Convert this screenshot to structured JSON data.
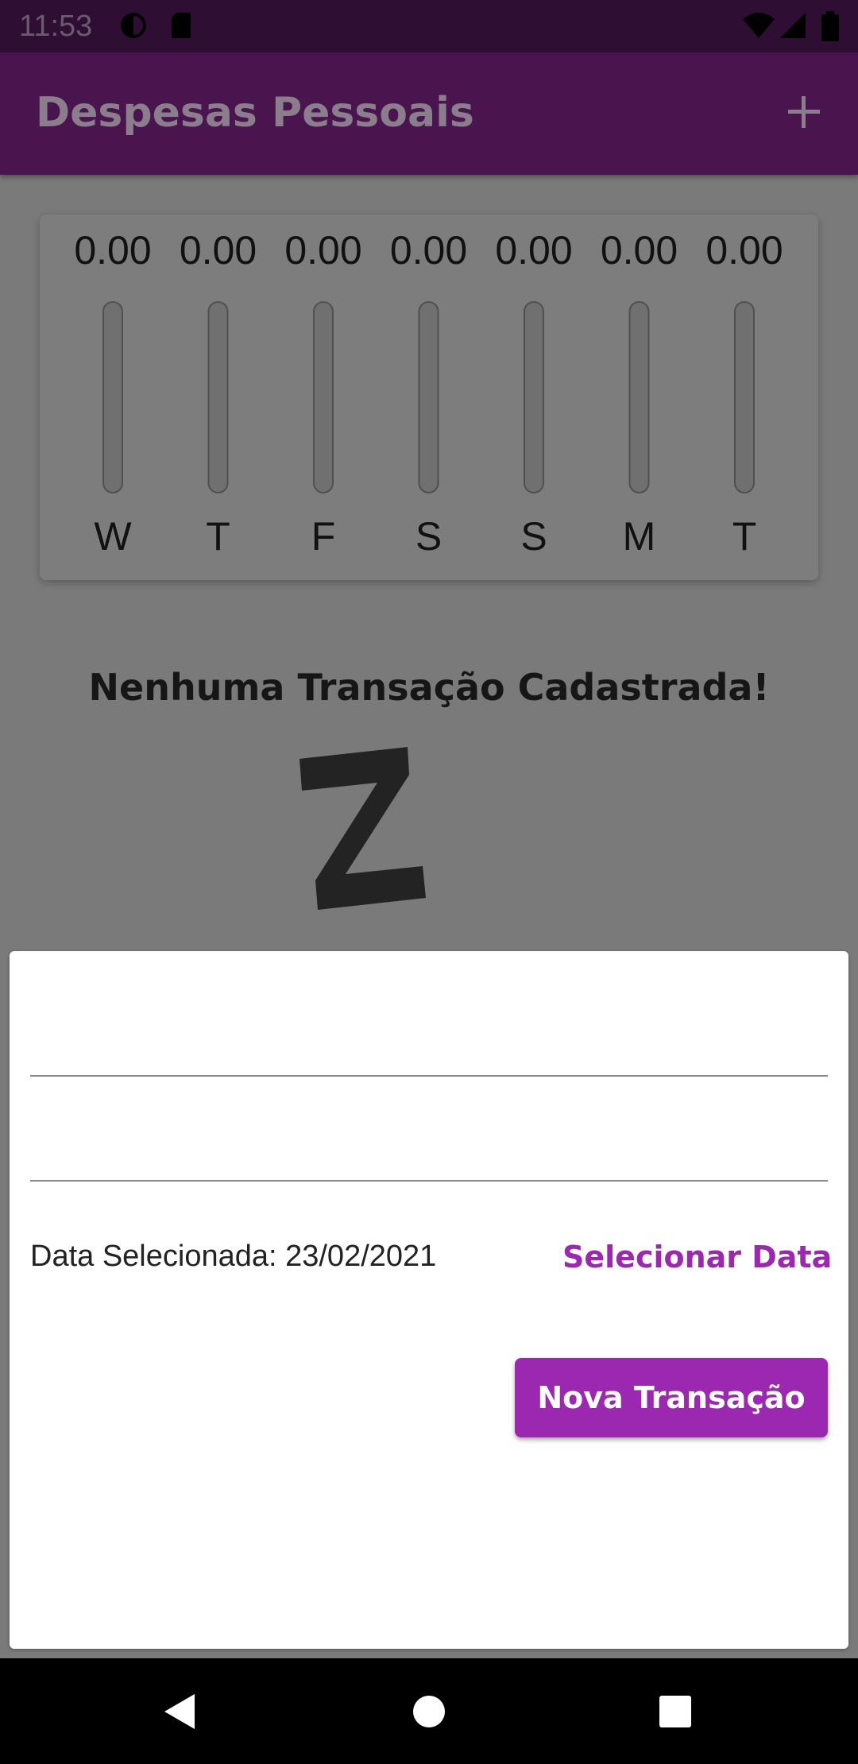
{
  "status_bar": {
    "time": "11:53"
  },
  "app_bar": {
    "title": "Despesas Pessoais"
  },
  "chart_data": {
    "type": "bar",
    "categories": [
      "W",
      "T",
      "F",
      "S",
      "S",
      "M",
      "T"
    ],
    "values": [
      0.0,
      0.0,
      0.0,
      0.0,
      0.0,
      0.0,
      0.0
    ],
    "value_labels": [
      "0.00",
      "0.00",
      "0.00",
      "0.00",
      "0.00",
      "0.00",
      "0.00"
    ],
    "title": "",
    "xlabel": "",
    "ylabel": "",
    "ylim": [
      0,
      1
    ]
  },
  "empty_state": {
    "message": "Nenhuma Transação Cadastrada!"
  },
  "form": {
    "title_value": "",
    "value_value": "",
    "date_label": "Data Selecionada: 23/02/2021",
    "select_date_label": "Selecionar Data",
    "submit_label": "Nova Transação"
  },
  "colors": {
    "primary": "#9c27b0",
    "app_bar_dimmed": "#4a144f",
    "scrim_background": "#7a7a7a"
  }
}
